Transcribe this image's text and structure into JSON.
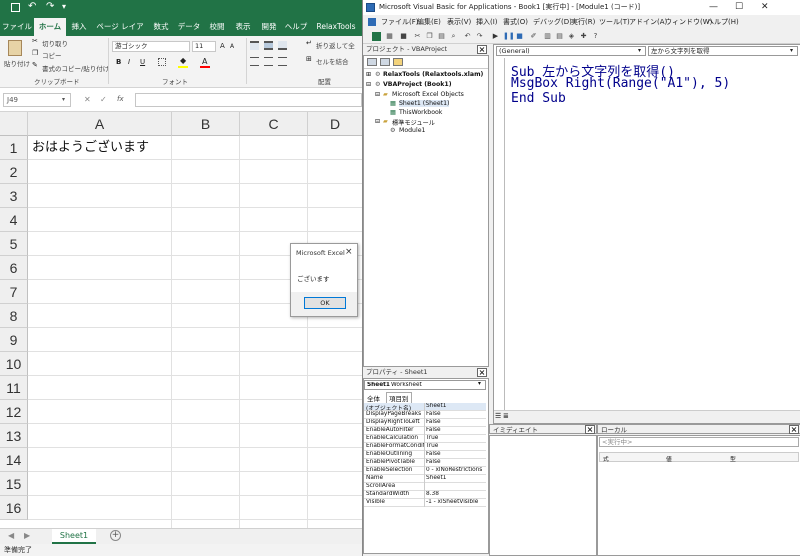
{
  "excel": {
    "tabs": [
      "ファイル",
      "ホーム",
      "挿入",
      "ページ レイアウト",
      "数式",
      "データ",
      "校閲",
      "表示",
      "開発",
      "ヘルプ",
      "RelaxTools"
    ],
    "active_tab": "ホーム",
    "clipboard": {
      "paste": "貼り付け",
      "cut": "切り取り",
      "copy": "コピー",
      "format_painter": "書式のコピー/貼り付け",
      "group": "クリップボード"
    },
    "font": {
      "name": "游ゴシック",
      "size": "11",
      "group": "フォント",
      "bold": "B",
      "italic": "I",
      "underline": "U"
    },
    "alignment": {
      "wrap": "折り返して全",
      "merge": "セルを結合",
      "group": "配置"
    },
    "name_box": "J49",
    "fx": "fx",
    "columns": [
      "A",
      "B",
      "C",
      "D"
    ],
    "rows": [
      "1",
      "2",
      "3",
      "4",
      "5",
      "6",
      "7",
      "8",
      "9",
      "10",
      "11",
      "12",
      "13",
      "14",
      "15",
      "16"
    ],
    "cell_a1": "おはようございます",
    "sheet_tab": "Sheet1",
    "status": "準備完了",
    "msgbox": {
      "title": "Microsoft Excel",
      "text": "ございます",
      "ok": "OK",
      "close": "×"
    }
  },
  "vba": {
    "title": "Microsoft Visual Basic for Applications - Book1 [実行中] - [Module1 (コード)]",
    "menu": [
      "ファイル(F)",
      "編集(E)",
      "表示(V)",
      "挿入(I)",
      "書式(O)",
      "デバッグ(D)",
      "実行(R)",
      "ツール(T)",
      "アドイン(A)",
      "ウィンドウ(W)",
      "ヘルプ(H)"
    ],
    "project_title": "プロジェクト - VBAProject",
    "tree": [
      {
        "label": "RelaxTools (Relaxtools.xlam)",
        "bold": true
      },
      {
        "label": "VBAProject (Book1)",
        "bold": true
      },
      {
        "label": "Microsoft Excel Objects",
        "bold": false
      },
      {
        "label": "Sheet1 (Sheet1)",
        "bold": false
      },
      {
        "label": "ThisWorkbook",
        "bold": false
      },
      {
        "label": "標準モジュール",
        "bold": false
      },
      {
        "label": "Module1",
        "bold": false
      }
    ],
    "properties_title": "プロパティ - Sheet1",
    "properties_object": "Sheet1",
    "properties_object_type": "Worksheet",
    "properties_tabs": [
      "全体",
      "項目別"
    ],
    "properties": [
      [
        "(オブジェクト名)",
        "Sheet1"
      ],
      [
        "DisplayPageBreaks",
        "False"
      ],
      [
        "DisplayRightToLeft",
        "False"
      ],
      [
        "EnableAutoFilter",
        "False"
      ],
      [
        "EnableCalculation",
        "True"
      ],
      [
        "EnableFormatConditio",
        "True"
      ],
      [
        "EnableOutlining",
        "False"
      ],
      [
        "EnablePivotTable",
        "False"
      ],
      [
        "EnableSelection",
        "0 - xlNoRestrictions"
      ],
      [
        "Name",
        "Sheet1"
      ],
      [
        "ScrollArea",
        ""
      ],
      [
        "StandardWidth",
        "8.38"
      ],
      [
        "Visible",
        "-1 - xlSheetVisible"
      ]
    ],
    "code_combo_left": "(General)",
    "code_combo_right": "左から文字列を取得",
    "code_lines": [
      "Sub 左から文字列を取得()",
      "MsgBox Right(Range(\"A1\"), 5)",
      "End Sub"
    ],
    "immediate_title": "イミディエイト",
    "locals_title": "ローカル",
    "locals_status": "<実行中>",
    "locals_columns": [
      "式",
      "値",
      "型"
    ]
  }
}
